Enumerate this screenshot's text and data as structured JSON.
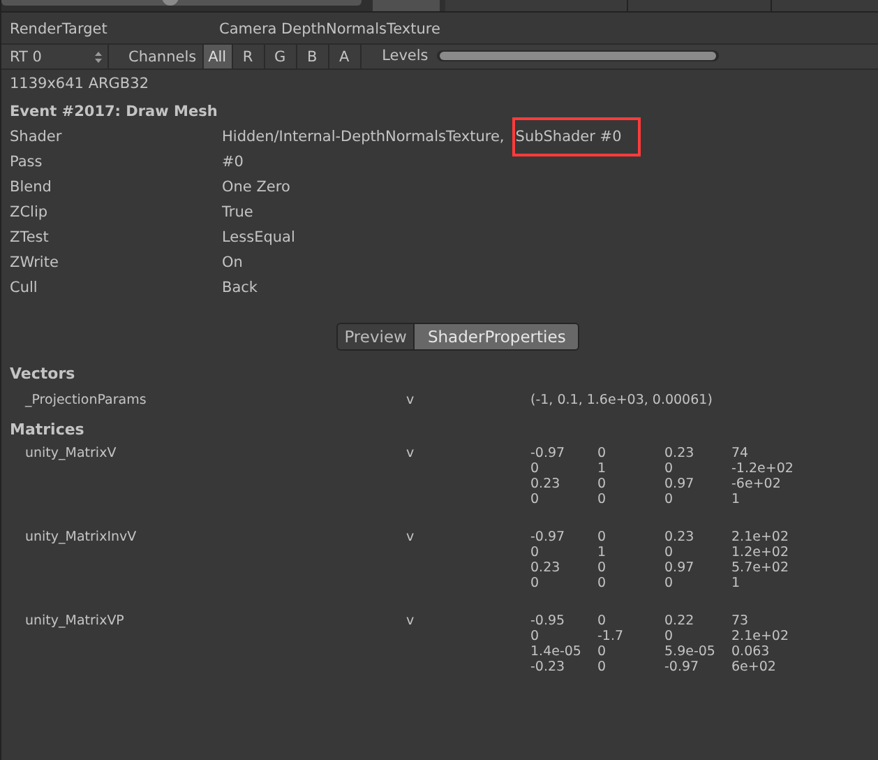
{
  "event_slider": {
    "level": 0.47
  },
  "header": {
    "label": "RenderTarget",
    "value": "Camera DepthNormalsTexture"
  },
  "toolbar": {
    "target": "RT 0",
    "channels_label": "Channels",
    "channels": [
      {
        "label": "All",
        "selected": true
      },
      {
        "label": "R",
        "selected": false
      },
      {
        "label": "G",
        "selected": false
      },
      {
        "label": "B",
        "selected": false
      },
      {
        "label": "A",
        "selected": false
      }
    ],
    "levels_label": "Levels",
    "levels": {
      "level": 1
    }
  },
  "format": "1139x641 ARGB32",
  "event": {
    "title": "Event #2017: Draw Mesh",
    "rows": [
      {
        "label": "Shader",
        "parts": [
          {
            "text": "Hidden/Internal-DepthNormalsTexture,",
            "highlighted": false
          },
          {
            "text": "SubShader #0",
            "highlighted": true
          }
        ]
      },
      {
        "label": "Pass",
        "parts": [
          {
            "text": "#0",
            "highlighted": false
          }
        ]
      },
      {
        "label": "Blend",
        "parts": [
          {
            "text": "One Zero",
            "highlighted": false
          }
        ]
      },
      {
        "label": "ZClip",
        "parts": [
          {
            "text": "True",
            "highlighted": false
          }
        ]
      },
      {
        "label": "ZTest",
        "parts": [
          {
            "text": "LessEqual",
            "highlighted": false
          }
        ]
      },
      {
        "label": "ZWrite",
        "parts": [
          {
            "text": "On",
            "highlighted": false
          }
        ]
      },
      {
        "label": "Cull",
        "parts": [
          {
            "text": "Back",
            "highlighted": false
          }
        ]
      }
    ]
  },
  "tabs": [
    {
      "label": "Preview",
      "selected": false
    },
    {
      "label": "ShaderProperties",
      "selected": true
    }
  ],
  "vectors": {
    "title": "Vectors",
    "items": [
      {
        "name": "_ProjectionParams",
        "stage": "v",
        "value": "(-1, 0.1, 1.6e+03, 0.00061)"
      }
    ]
  },
  "matrices": {
    "title": "Matrices",
    "items": [
      {
        "name": "unity_MatrixV",
        "stage": "v",
        "rows": [
          [
            "-0.97",
            "0",
            "0.23",
            "74"
          ],
          [
            "0",
            "1",
            "0",
            "-1.2e+02"
          ],
          [
            "0.23",
            "0",
            "0.97",
            "-6e+02"
          ],
          [
            "0",
            "0",
            "0",
            "1"
          ]
        ]
      },
      {
        "name": "unity_MatrixInvV",
        "stage": "v",
        "rows": [
          [
            "-0.97",
            "0",
            "0.23",
            "2.1e+02"
          ],
          [
            "0",
            "1",
            "0",
            "1.2e+02"
          ],
          [
            "0.23",
            "0",
            "0.97",
            "5.7e+02"
          ],
          [
            "0",
            "0",
            "0",
            "1"
          ]
        ]
      },
      {
        "name": "unity_MatrixVP",
        "stage": "v",
        "rows": [
          [
            "-0.95",
            "0",
            "0.22",
            "73"
          ],
          [
            "0",
            "-1.7",
            "0",
            "2.1e+02"
          ],
          [
            "1.4e-05",
            "0",
            "5.9e-05",
            "0.063"
          ],
          [
            "-0.23",
            "0",
            "-0.97",
            "6e+02"
          ]
        ]
      }
    ]
  }
}
